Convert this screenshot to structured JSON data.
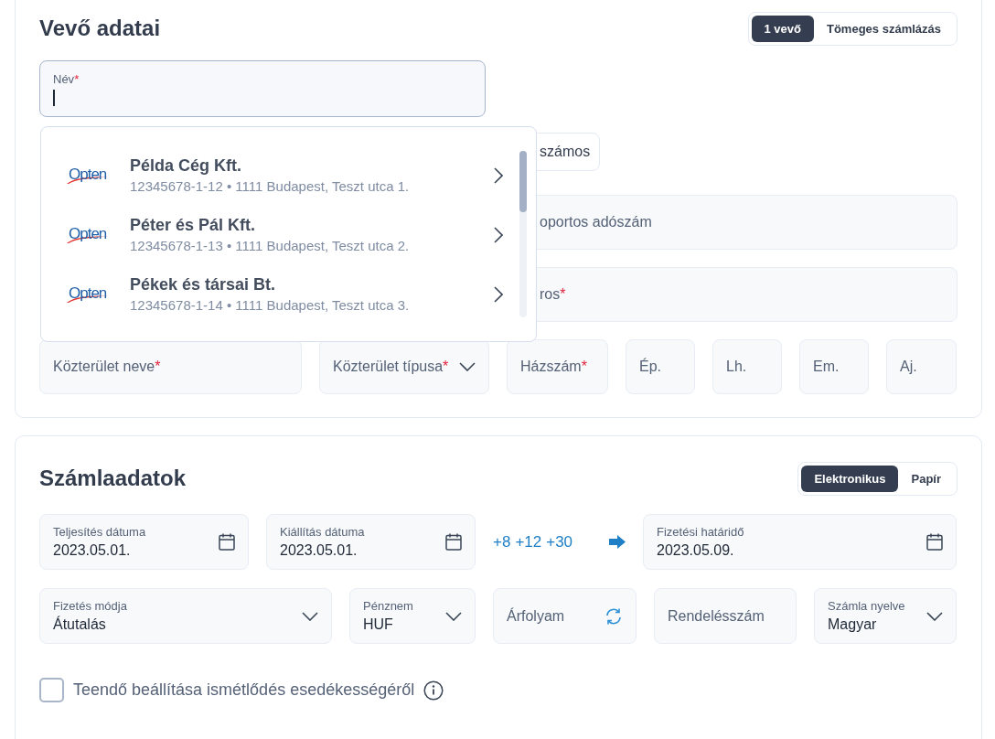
{
  "required_mark": "*",
  "buyer": {
    "title": "Vevő adatai",
    "mode_toggle": [
      {
        "label": "1 vevő",
        "selected": true
      },
      {
        "label": "Tömeges számlázás",
        "selected": false
      }
    ],
    "name_field": {
      "label": "Név",
      "required": true,
      "focused": true
    },
    "covered_items": [
      {
        "kind": "button",
        "label": "számos"
      },
      {
        "kind": "field",
        "placeholder": "oportos adószám",
        "required": false
      },
      {
        "kind": "field",
        "placeholder": "ros",
        "required": true
      }
    ],
    "address_fields": [
      {
        "kind": "text",
        "placeholder": "Közterület neve",
        "required": true
      },
      {
        "kind": "select",
        "placeholder": "Közterület típusa",
        "required": true
      },
      {
        "kind": "text",
        "placeholder": "Házszám",
        "required": true
      },
      {
        "kind": "text",
        "placeholder": "Ép.",
        "required": false
      },
      {
        "kind": "text",
        "placeholder": "Lh.",
        "required": false
      },
      {
        "kind": "text",
        "placeholder": "Em.",
        "required": false
      },
      {
        "kind": "text",
        "placeholder": "Aj.",
        "required": false
      }
    ],
    "suggestions": [
      {
        "logo": "Opten",
        "name": "Példa Cég Kft.",
        "detail": "12345678-1-12 • 1111 Budapest, Teszt utca 1."
      },
      {
        "logo": "Opten",
        "name": "Péter és Pál Kft.",
        "detail": "12345678-1-13 • 1111 Budapest, Teszt utca 2."
      },
      {
        "logo": "Opten",
        "name": "Pékek és társai Bt.",
        "detail": "12345678-1-14 • 1111 Budapest, Teszt utca 3."
      }
    ]
  },
  "invoice": {
    "title": "Számlaadatok",
    "delivery_toggle": [
      {
        "label": "Elektronikus",
        "selected": true
      },
      {
        "label": "Papír",
        "selected": false
      }
    ],
    "date_fields": [
      {
        "kind": "date",
        "label": "Teljesítés dátuma",
        "value": "2023.05.01."
      },
      {
        "kind": "date",
        "label": "Kiállítás dátuma",
        "value": "2023.05.01."
      }
    ],
    "quick_offsets": [
      "+8",
      "+12",
      "+30"
    ],
    "due_field": {
      "kind": "date",
      "label": "Fizetési határidő",
      "value": "2023.05.09."
    },
    "detail_fields": [
      {
        "kind": "select",
        "label": "Fizetés módja",
        "value": "Átutalás"
      },
      {
        "kind": "select",
        "label": "Pénznem",
        "value": "HUF"
      },
      {
        "kind": "refresh",
        "placeholder": "Árfolyam"
      },
      {
        "kind": "text",
        "placeholder": "Rendelésszám"
      },
      {
        "kind": "select",
        "label": "Számla nyelve",
        "value": "Magyar"
      }
    ],
    "reminder": {
      "label": "Teendő beállítása ismétlődés esedékességéről",
      "checked": false
    }
  }
}
